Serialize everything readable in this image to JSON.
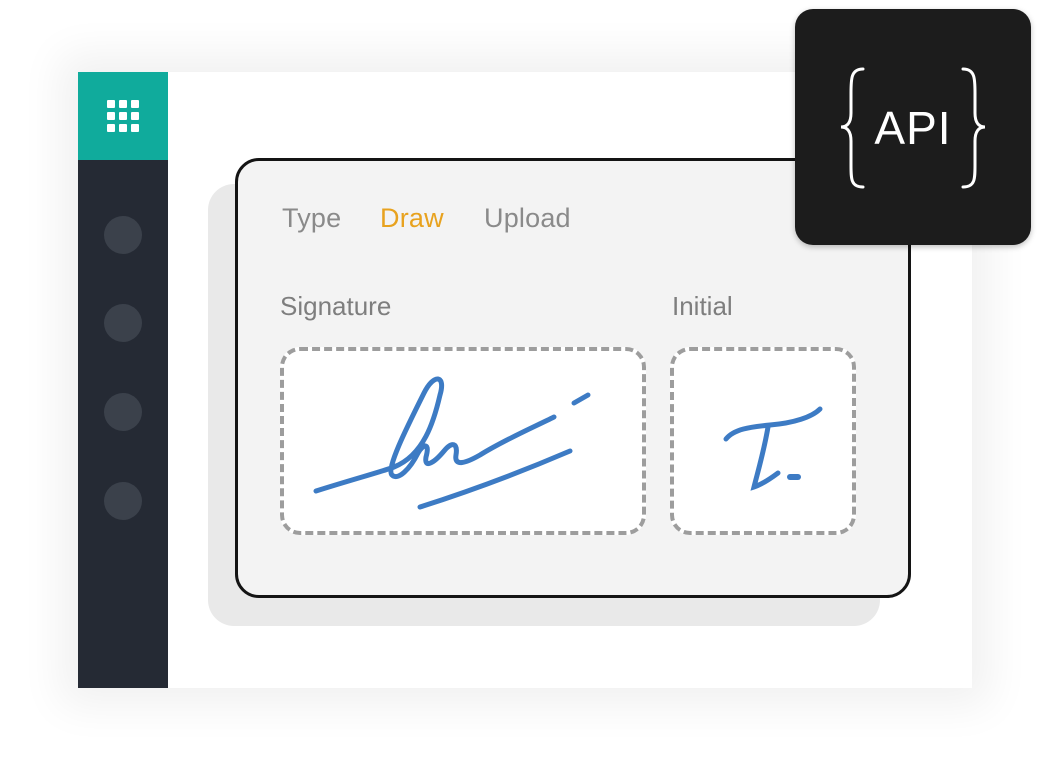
{
  "sidebar": {
    "menu_icon": "grid-icon",
    "accent_color": "#10ab9c",
    "items": [
      "nav-item-1",
      "nav-item-2",
      "nav-item-3",
      "nav-item-4"
    ]
  },
  "signature_panel": {
    "tabs": [
      {
        "label": "Type",
        "active": false
      },
      {
        "label": "Draw",
        "active": true
      },
      {
        "label": "Upload",
        "active": false
      }
    ],
    "active_tab_color": "#e8a21e",
    "signature_label": "Signature",
    "initial_label": "Initial",
    "ink_color": "#3d7bc4"
  },
  "api_badge": {
    "text": "API",
    "icon": "curly-braces-icon"
  }
}
